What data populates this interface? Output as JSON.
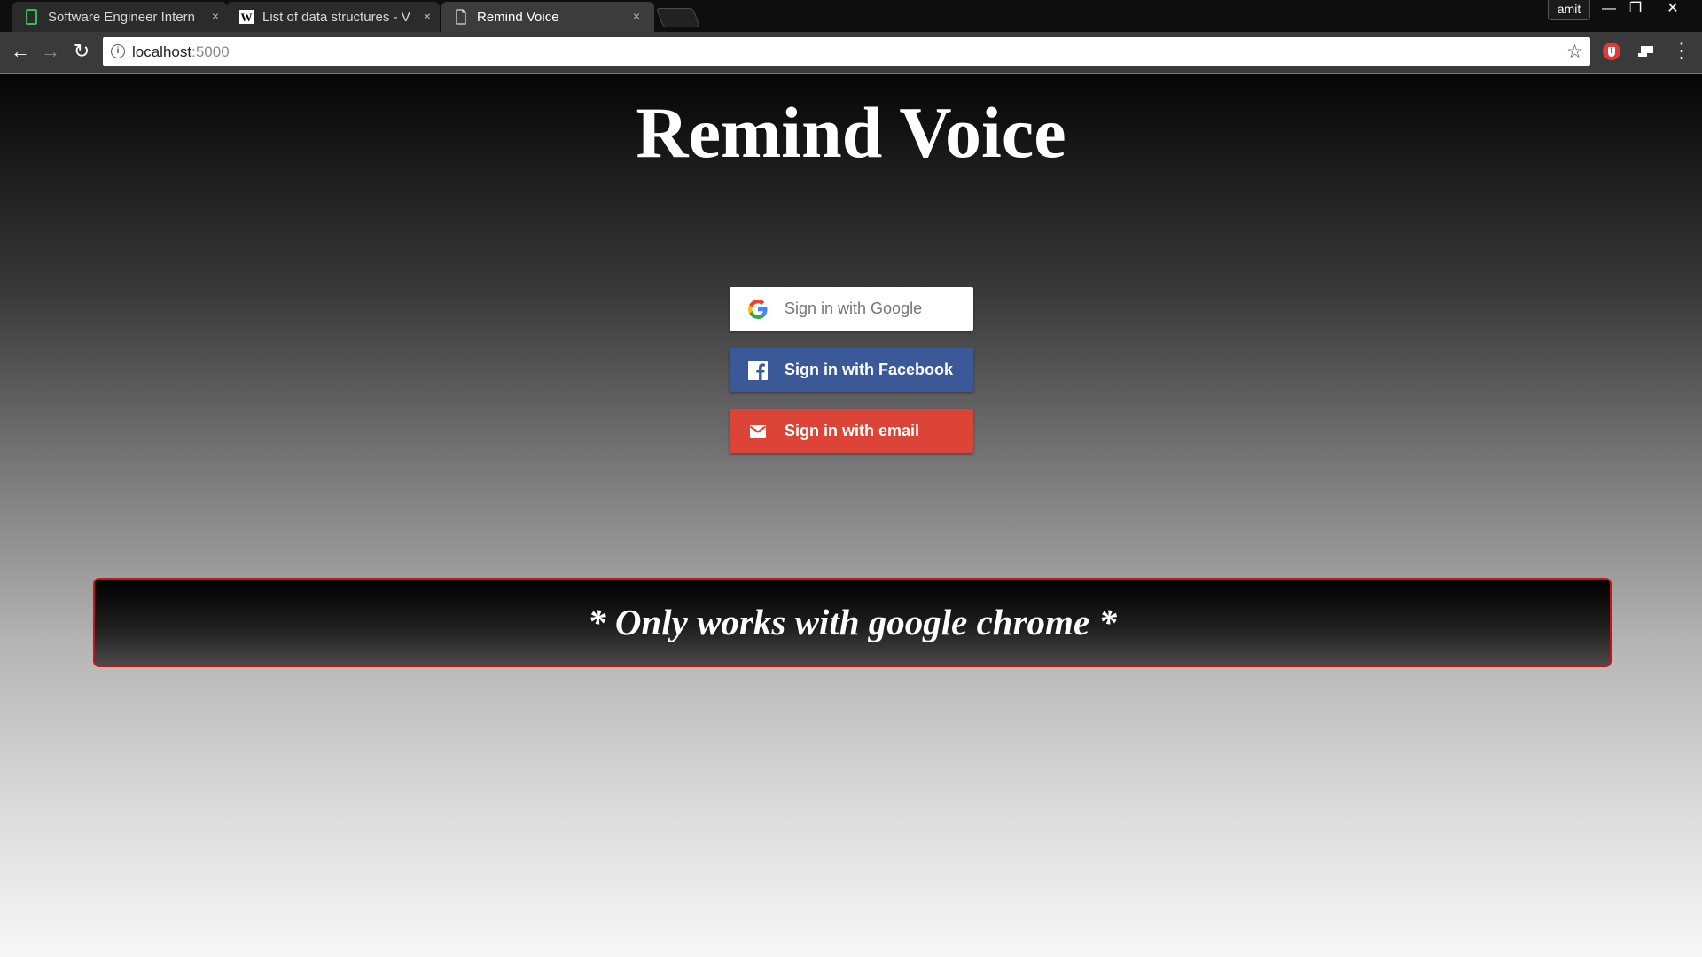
{
  "browser": {
    "tabs": [
      {
        "title": "Software Engineer Intern",
        "icon": "green-page-icon",
        "close": "×"
      },
      {
        "title": "List of data structures - V",
        "icon": "wikipedia-icon",
        "close": "×"
      },
      {
        "title": "Remind Voice",
        "icon": "document-icon",
        "close": "×"
      }
    ],
    "profile_name": "amit",
    "window_controls": {
      "minimize": "—",
      "restore": "❐",
      "close": "✕"
    },
    "nav": {
      "back": "←",
      "forward": "→",
      "reload": "↻"
    },
    "url_host": "localhost",
    "url_port": ":5000",
    "bookmark_star": "☆",
    "menu_dots": "⋮"
  },
  "page": {
    "title": "Remind Voice",
    "buttons": {
      "google": "Sign in with Google",
      "facebook": "Sign in with Facebook",
      "email": "Sign in with email"
    },
    "notice": "* Only works with google chrome *"
  },
  "colors": {
    "google_button_bg": "#ffffff",
    "facebook_button_bg": "#3b5998",
    "email_button_bg": "#db4437",
    "notice_border": "#c01818"
  }
}
